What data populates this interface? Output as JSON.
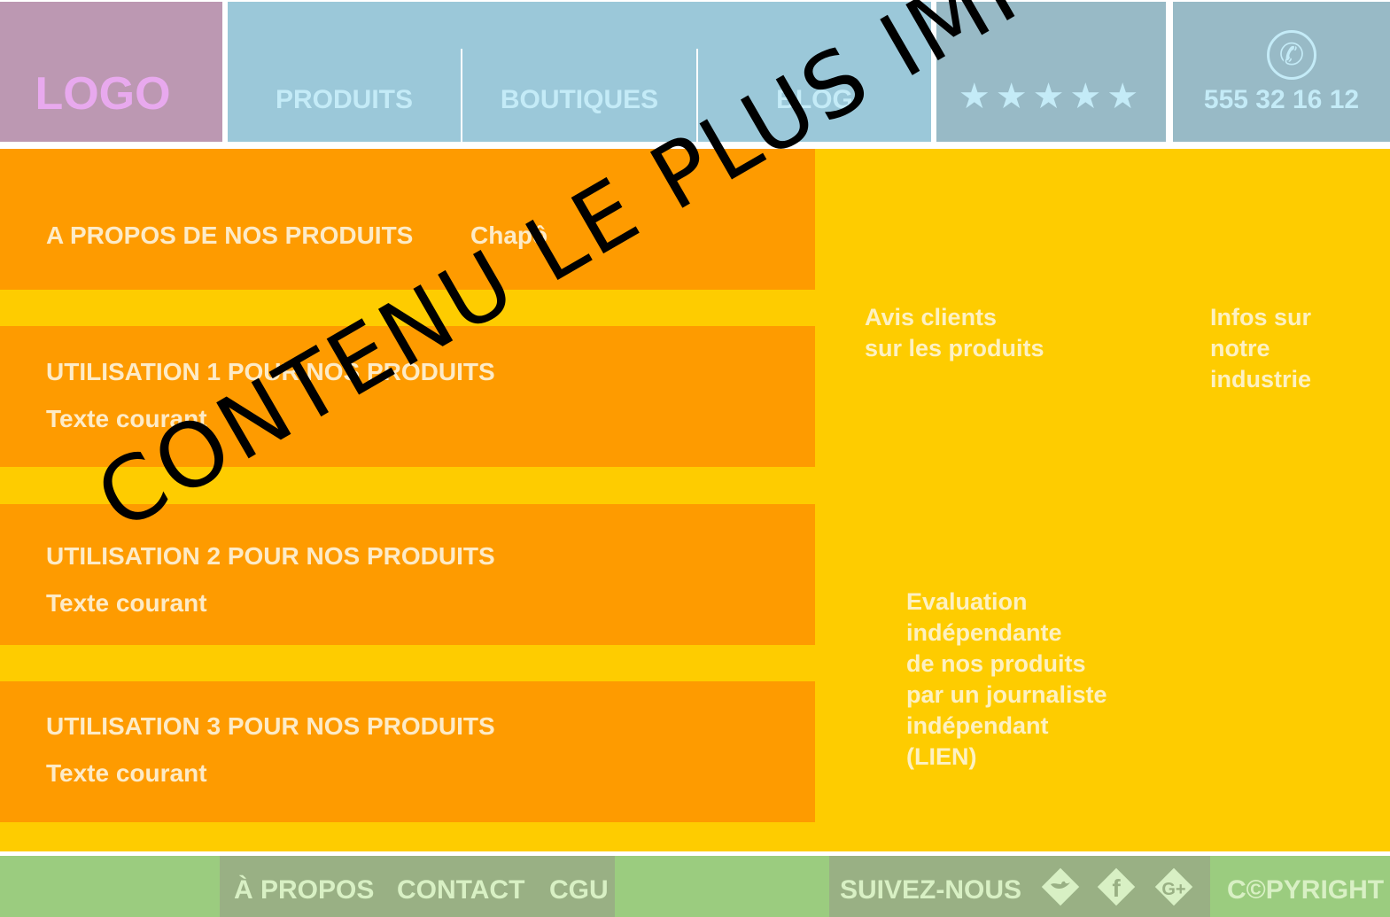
{
  "header": {
    "logo": "LOGO",
    "nav": [
      "PRODUITS",
      "BOUTIQUES",
      "BLOG"
    ],
    "rating": {
      "stars_text": "★★★★★",
      "value": 5,
      "max": 5
    },
    "phone_icon": "phone-icon",
    "phone_number": "555 32 16 12"
  },
  "main": {
    "sections": [
      {
        "title": "A PROPOS DE NOS PRODUITS",
        "extra": "Chapô",
        "text": ""
      },
      {
        "title": "UTILISATION 1 POUR NOS PRODUITS",
        "text": "Texte courant"
      },
      {
        "title": "UTILISATION 2 POUR NOS PRODUITS",
        "text": "Texte courant"
      },
      {
        "title": "UTILISATION 3 POUR NOS PRODUITS",
        "text": "Texte courant"
      }
    ],
    "side": {
      "reviews": [
        "Avis clients",
        "sur les produits"
      ],
      "industry": [
        "Infos sur",
        "notre",
        "industrie"
      ],
      "evaluation": [
        "Evaluation",
        "indépendante",
        "de nos produits",
        "par un journaliste",
        "indépendant",
        "(LIEN)"
      ]
    },
    "watermark": "CONTENU LE PLUS IMPORTANT"
  },
  "footer": {
    "links": [
      "À PROPOS",
      "CONTACT",
      "CGU"
    ],
    "follow_label": "SUIVEZ-NOUS",
    "social_icons": [
      "twitter-icon",
      "facebook-icon",
      "google-plus-icon"
    ],
    "copyright": "C©PYRIGHT"
  },
  "colors": {
    "logo_bg": "#bc98b2",
    "nav_bg": "#9bc8d9",
    "header_side_bg": "#98bac6",
    "section_orange": "#fe9b00",
    "main_yellow": "#fecc00",
    "footer_green": "#9bcc7f",
    "footer_dark": "#99b084"
  }
}
